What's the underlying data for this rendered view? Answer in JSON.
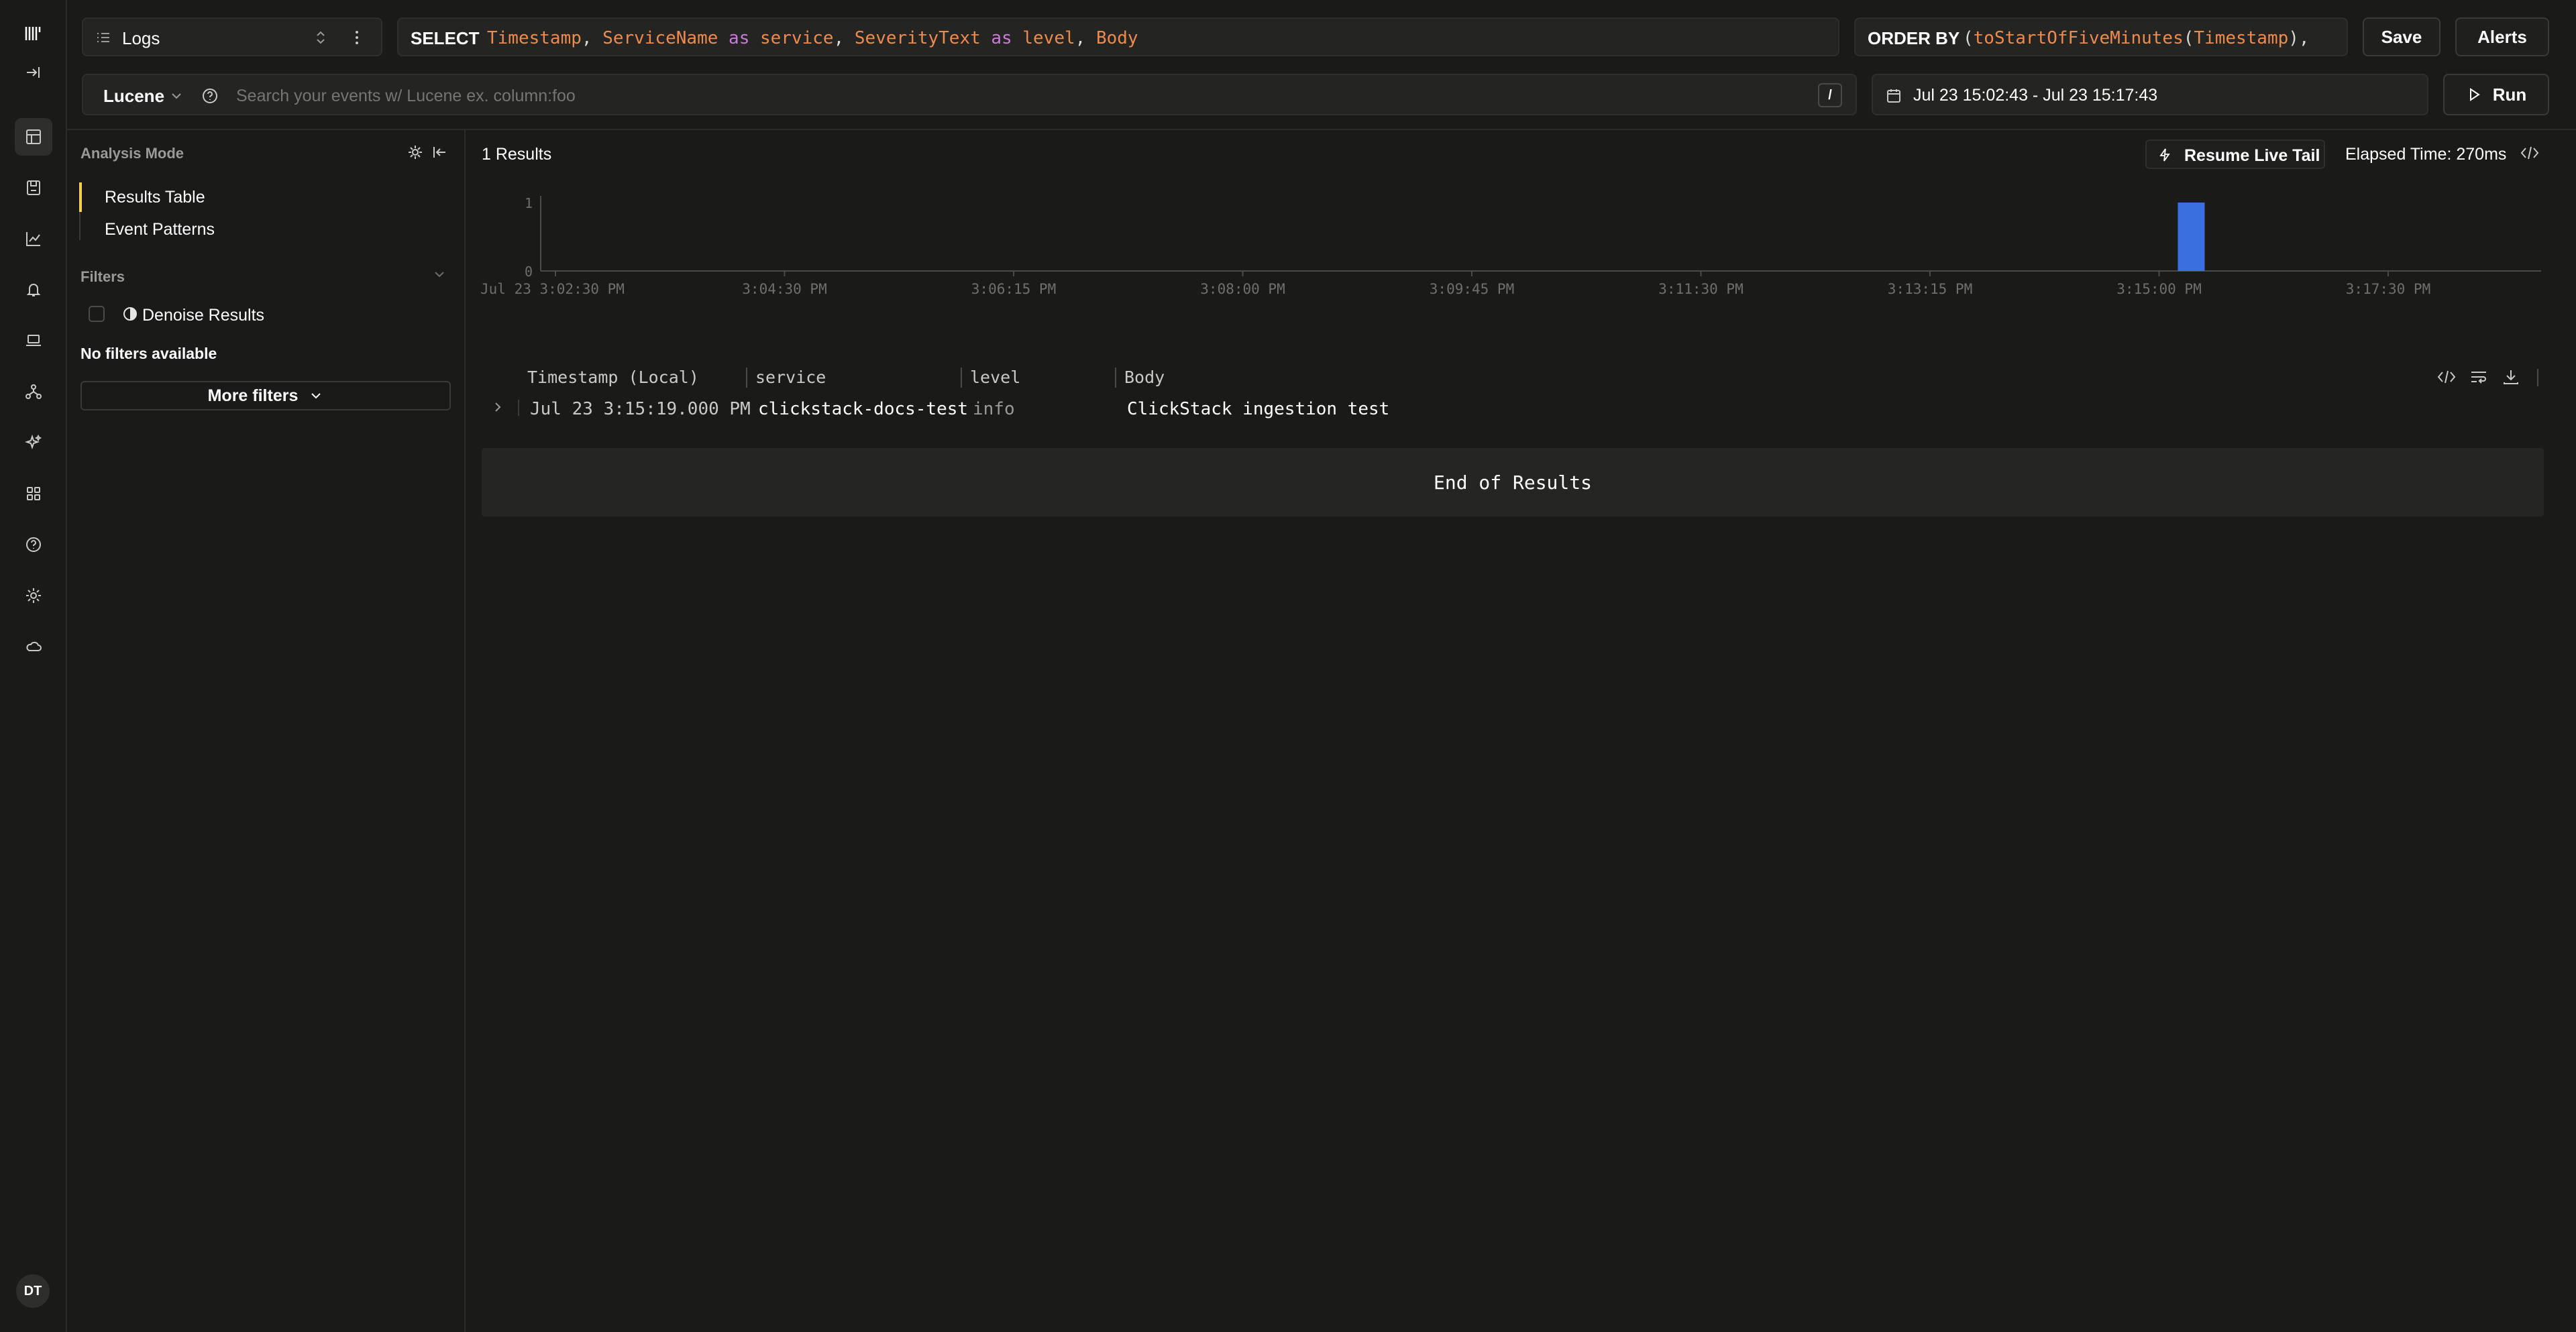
{
  "source": {
    "label": "Logs"
  },
  "select": {
    "keyword": "SELECT",
    "tokens": [
      {
        "t": "Timestamp",
        "c": "col"
      },
      {
        "t": ", ",
        "c": "punc"
      },
      {
        "t": "ServiceName",
        "c": "col"
      },
      {
        "t": " as ",
        "c": "op"
      },
      {
        "t": "service",
        "c": "col"
      },
      {
        "t": ", ",
        "c": "punc"
      },
      {
        "t": "SeverityText",
        "c": "col"
      },
      {
        "t": " as ",
        "c": "op"
      },
      {
        "t": "level",
        "c": "col"
      },
      {
        "t": ", ",
        "c": "punc"
      },
      {
        "t": "Body",
        "c": "col"
      }
    ]
  },
  "order_by": {
    "keyword": "ORDER BY",
    "tokens": [
      {
        "t": "(",
        "c": "punc"
      },
      {
        "t": "toStartOfFiveMinutes",
        "c": "fn"
      },
      {
        "t": "(",
        "c": "punc"
      },
      {
        "t": "Timestamp",
        "c": "col"
      },
      {
        "t": "),",
        "c": "punc"
      }
    ]
  },
  "buttons": {
    "save": "Save",
    "alerts": "Alerts",
    "run": "Run",
    "more_filters": "More filters",
    "resume_live_tail": "Resume Live Tail"
  },
  "search": {
    "mode": "Lucene",
    "placeholder": "Search your events w/ Lucene ex. column:foo",
    "shortcut": "/"
  },
  "time_range": "Jul 23 15:02:43 - Jul 23 15:17:43",
  "sidebar": {
    "analysis_mode": "Analysis Mode",
    "modes": [
      "Results Table",
      "Event Patterns"
    ],
    "filters_label": "Filters",
    "denoise_label": "Denoise Results",
    "no_filters": "No filters available"
  },
  "results": {
    "count_text": "1 Results",
    "elapsed": "Elapsed Time: 270ms",
    "end_text": "End of Results"
  },
  "chart_data": {
    "type": "bar",
    "x_ticks": [
      "Jul 23 3:02:30 PM",
      "3:04:30 PM",
      "3:06:15 PM",
      "3:08:00 PM",
      "3:09:45 PM",
      "3:11:30 PM",
      "3:13:15 PM",
      "3:15:00 PM",
      "3:17:30 PM"
    ],
    "y_ticks": [
      0,
      1
    ],
    "ylim": [
      0,
      1
    ],
    "bars": [
      {
        "x": "3:15:00 PM",
        "value": 1
      }
    ],
    "bar_color": "#3a6fe0"
  },
  "table": {
    "columns": [
      "Timestamp (Local)",
      "service",
      "level",
      "Body"
    ],
    "rows": [
      {
        "timestamp": "Jul 23 3:15:19.000 PM",
        "service": "clickstack-docs-test",
        "level": "info",
        "body": "ClickStack ingestion test"
      }
    ]
  },
  "user": {
    "initials": "DT"
  }
}
